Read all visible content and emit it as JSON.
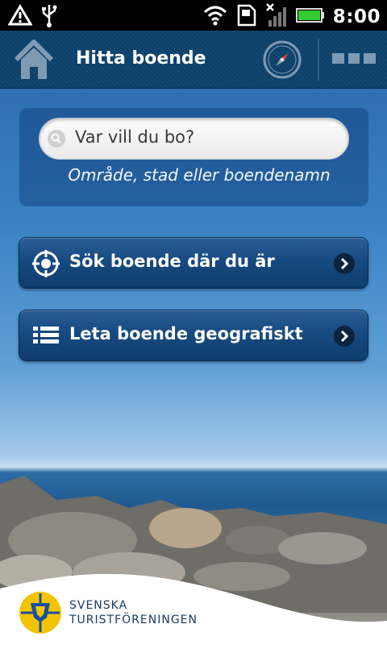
{
  "status_bar": {
    "time": "8:00",
    "icons": [
      "warning-icon",
      "usb-icon",
      "wifi-icon",
      "sd-card-icon",
      "no-signal-icon",
      "battery-icon"
    ],
    "battery_color": "#33cc33"
  },
  "action_bar": {
    "title": "Hitta boende",
    "icons": [
      "home-icon",
      "compass-icon",
      "menu-icon"
    ]
  },
  "search": {
    "placeholder": "Var vill du bo?",
    "hint": "Område, stad eller boendenamn"
  },
  "nav": {
    "nearby_label": "Sök boende där du är",
    "geographic_label": "Leta boende geografiskt"
  },
  "logo": {
    "line1": "SVENSKA",
    "line2": "TURISTFÖRENINGEN"
  },
  "colors": {
    "action_bar": "#0e3f66",
    "button": "#164a80",
    "logo_yellow": "#f2c400",
    "logo_blue": "#1b4f9c"
  }
}
